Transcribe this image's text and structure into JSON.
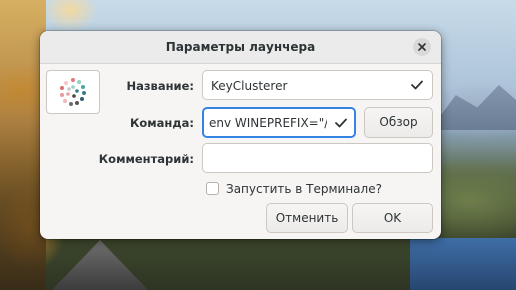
{
  "dialog": {
    "title": "Параметры лаунчера",
    "name_label": "Название:",
    "name_value": "KeyClusterer",
    "command_label": "Команда:",
    "command_value": "env WINEPREFIX=\"/h",
    "browse_label": "Обзор",
    "comment_label": "Комментарий:",
    "comment_value": "",
    "terminal_label": "Запустить в Терминале?",
    "terminal_checked": false,
    "cancel_label": "Отменить",
    "ok_label": "OK"
  },
  "icons": {
    "close": "close-icon",
    "app": "app-dots-icon",
    "check": "checkmark-icon"
  },
  "colors": {
    "accent": "#3584e4",
    "dialog_bg": "#f6f5f4"
  }
}
